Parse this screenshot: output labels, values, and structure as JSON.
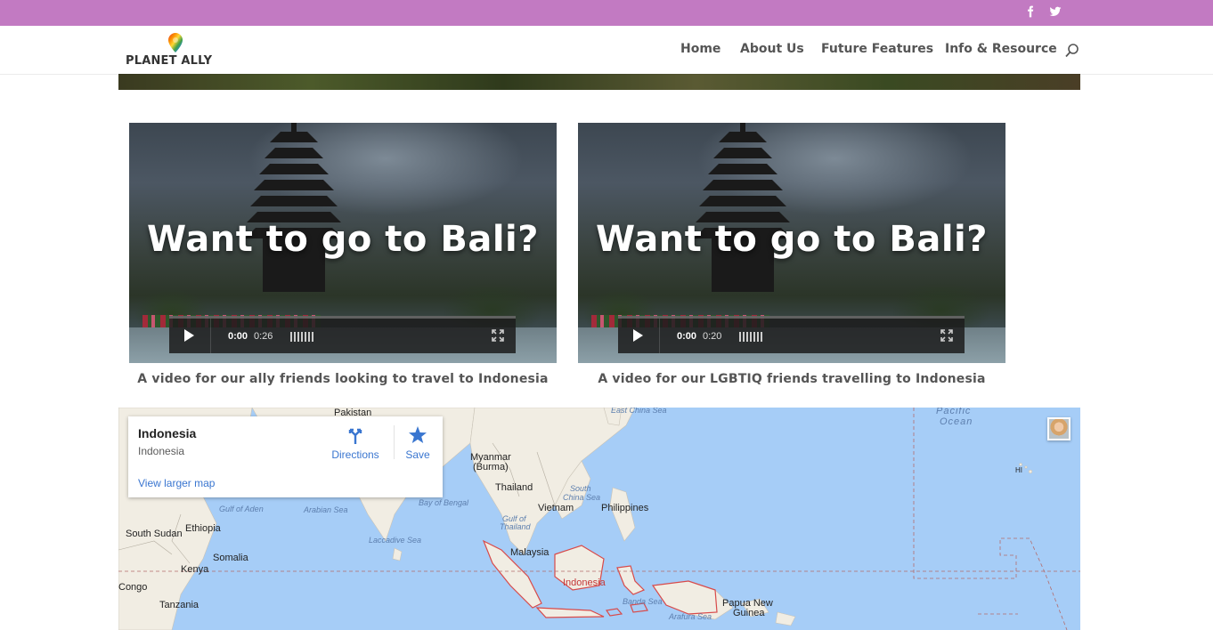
{
  "topbar": {
    "color": "#c27ac2",
    "social": [
      "facebook-icon",
      "twitter-icon"
    ]
  },
  "header": {
    "logo_text": "PLANET ALLY",
    "nav": [
      {
        "label": "Home"
      },
      {
        "label": "About Us"
      },
      {
        "label": "Future Features"
      },
      {
        "label": "Info & Resource"
      }
    ],
    "search_icon": "search-icon"
  },
  "videos": [
    {
      "title": "Want to go to Bali?",
      "current_time": "0:00",
      "duration": "0:26",
      "caption": "A video for our ally friends looking to travel to Indonesia"
    },
    {
      "title": "Want to go to Bali?",
      "current_time": "0:00",
      "duration": "0:20",
      "caption": "A video for our LGBTIQ friends travelling to Indonesia"
    }
  ],
  "map": {
    "card": {
      "title": "Indonesia",
      "subtitle": "Indonesia",
      "directions_label": "Directions",
      "save_label": "Save",
      "view_larger": "View larger map"
    },
    "labels": {
      "pakistan": "Pakistan",
      "east_china_sea": "East China Sea",
      "pacific_ocean_1": "Pacific",
      "pacific_ocean_2": "Ocean",
      "hi": "HI",
      "myanmar_1": "Myanmar",
      "myanmar_2": "(Burma)",
      "thailand": "Thailand",
      "south_china_sea_1": "South",
      "south_china_sea_2": "China Sea",
      "vietnam": "Vietnam",
      "philippines": "Philippines",
      "gulf_of_aden": "Gulf of Aden",
      "arabian_sea": "Arabian Sea",
      "bay_of_bengal": "Bay of Bengal",
      "gulf_of_thailand_1": "Gulf of",
      "gulf_of_thailand_2": "Thailand",
      "south_sudan": "South Sudan",
      "ethiopia": "Ethiopia",
      "laccadive_sea": "Laccadive Sea",
      "malaysia": "Malaysia",
      "somalia": "Somalia",
      "kenya": "Kenya",
      "congo": "Congo",
      "indonesia": "Indonesia",
      "tanzania": "Tanzania",
      "banda_sea": "Banda Sea",
      "papua_1": "Papua New",
      "papua_2": "Guinea",
      "arafura_sea": "Arafura Sea"
    },
    "highlight_color": "#d84a4a"
  }
}
